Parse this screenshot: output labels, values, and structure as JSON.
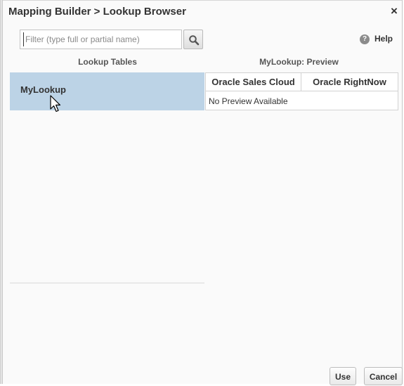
{
  "dialog": {
    "title": "Mapping Builder > Lookup Browser",
    "close_label": "×"
  },
  "filter": {
    "placeholder": "Filter (type full or partial name)",
    "value": ""
  },
  "help": {
    "icon_glyph": "?",
    "label": "Help"
  },
  "lookup_tables": {
    "header": "Lookup Tables",
    "items": [
      {
        "label": "MyLookup",
        "selected": true
      }
    ]
  },
  "preview": {
    "header": "MyLookup: Preview",
    "columns": [
      "Oracle Sales Cloud",
      "Oracle RightNow"
    ],
    "empty_message": "No Preview Available"
  },
  "buttons": {
    "use": "Use",
    "cancel": "Cancel"
  },
  "colors": {
    "selected_row": "#bcd3e6",
    "dialog_bg": "#fafafa"
  },
  "icons": {
    "close": "close-icon",
    "search": "search-icon",
    "help": "help-icon",
    "cursor": "mouse-cursor-icon"
  }
}
